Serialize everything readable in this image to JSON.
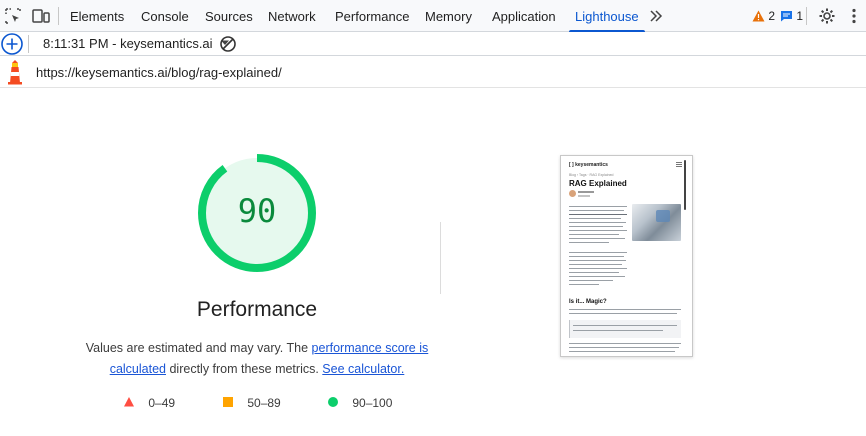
{
  "tabs": [
    {
      "label": "Elements"
    },
    {
      "label": "Console"
    },
    {
      "label": "Sources"
    },
    {
      "label": "Network"
    },
    {
      "label": "Performance"
    },
    {
      "label": "Memory"
    },
    {
      "label": "Application"
    },
    {
      "label": "Lighthouse"
    }
  ],
  "active_tab": "Lighthouse",
  "issues": {
    "warnings": "2",
    "messages": "1",
    "warning_color": "#e8710a",
    "message_color": "#1a73e8"
  },
  "toolbar": {
    "report_time": "8:11:31 PM - keysemantics.ai"
  },
  "url": "https://keysemantics.ai/blog/rag-explained/",
  "report": {
    "score": "90",
    "score_value": 90,
    "score_color": "#0cce6b",
    "category": "Performance",
    "desc_prefix": "Values are estimated and may vary. The ",
    "desc_link1": "performance score is calculated",
    "desc_mid": " directly from these metrics. ",
    "desc_link2": "See calculator."
  },
  "legend": [
    {
      "range": "0–49",
      "color": "#ff4e42",
      "shape": "triangle"
    },
    {
      "range": "50–89",
      "color": "#ffa400",
      "shape": "square"
    },
    {
      "range": "90–100",
      "color": "#0cce6b",
      "shape": "circle"
    }
  ],
  "thumbnail": {
    "logo": "[ ] keysemantics",
    "breadcrumb": "Blog › Tags · RAG Explained",
    "title": "RAG Explained",
    "heading": "Is it... Magic?"
  }
}
